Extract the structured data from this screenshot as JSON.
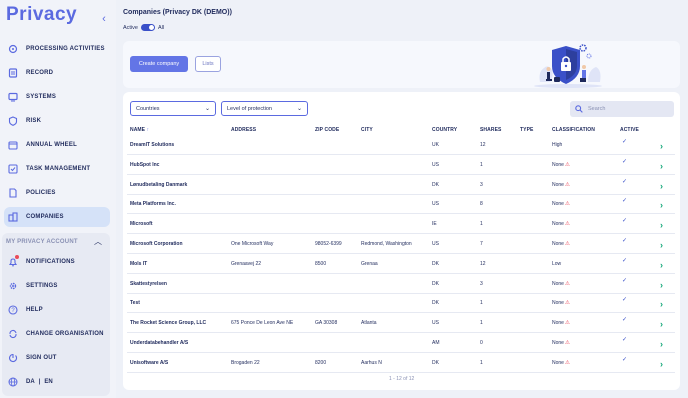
{
  "app": {
    "logo": "Privacy",
    "collapse_icon": "chevron-left-icon"
  },
  "sidebar": {
    "items": [
      {
        "label": "PROCESSING ACTIVITIES",
        "icon": "activities-icon"
      },
      {
        "label": "RECORD",
        "icon": "record-icon"
      },
      {
        "label": "SYSTEMS",
        "icon": "systems-icon"
      },
      {
        "label": "RISK",
        "icon": "risk-icon"
      },
      {
        "label": "ANNUAL WHEEL",
        "icon": "wheel-icon"
      },
      {
        "label": "TASK MANAGEMENT",
        "icon": "task-icon"
      },
      {
        "label": "POLICIES",
        "icon": "policies-icon"
      },
      {
        "label": "COMPANIES",
        "icon": "companies-icon"
      }
    ],
    "account_header": "MY PRIVACY ACCOUNT",
    "account_items": [
      {
        "label": "NOTIFICATIONS",
        "icon": "bell-icon"
      },
      {
        "label": "SETTINGS",
        "icon": "gear-icon"
      },
      {
        "label": "HELP",
        "icon": "help-icon"
      },
      {
        "label": "CHANGE ORGANISATION",
        "icon": "switch-icon"
      },
      {
        "label": "SIGN OUT",
        "icon": "sign-out-icon"
      }
    ],
    "lang": {
      "da": "DA",
      "sep": "|",
      "en": "EN"
    }
  },
  "page": {
    "title": "Companies (Privacy DK (DEMO))",
    "toggle_left": "Active",
    "toggle_right": "All"
  },
  "actions": {
    "create": "Create company",
    "lists": "Lists"
  },
  "filters": {
    "countries": "Countries",
    "level": "Level of protection",
    "search_placeholder": "Search"
  },
  "table": {
    "headers": {
      "name": "NAME",
      "address": "ADDRESS",
      "zip": "ZIP CODE",
      "city": "CITY",
      "country": "COUNTRY",
      "shares": "SHARES",
      "type": "TYPE",
      "classification": "CLASSIFICATION",
      "active": "ACTIVE"
    },
    "rows": [
      {
        "name": "DreamIT Solutions",
        "address": "",
        "zip": "",
        "city": "",
        "country": "UK",
        "shares": "12",
        "type": "",
        "classification": "High",
        "warn": false
      },
      {
        "name": "HubSpot Inc",
        "address": "",
        "zip": "",
        "city": "",
        "country": "US",
        "shares": "1",
        "type": "",
        "classification": "None",
        "warn": true
      },
      {
        "name": "Lønudbetaling Danmark",
        "address": "",
        "zip": "",
        "city": "",
        "country": "DK",
        "shares": "3",
        "type": "",
        "classification": "None",
        "warn": true
      },
      {
        "name": "Meta Platforms Inc.",
        "address": "",
        "zip": "",
        "city": "",
        "country": "US",
        "shares": "8",
        "type": "",
        "classification": "None",
        "warn": true
      },
      {
        "name": "Microsoft",
        "address": "",
        "zip": "",
        "city": "",
        "country": "IE",
        "shares": "1",
        "type": "",
        "classification": "None",
        "warn": true
      },
      {
        "name": "Microsoft Corporation",
        "address": "One Microsoft Way",
        "zip": "98052-6399",
        "city": "Redmond, Washington",
        "country": "US",
        "shares": "7",
        "type": "",
        "classification": "None",
        "warn": true
      },
      {
        "name": "Mols IT",
        "address": "Grenaavej 22",
        "zip": "8500",
        "city": "Grenaa",
        "country": "DK",
        "shares": "12",
        "type": "",
        "classification": "Low",
        "warn": false
      },
      {
        "name": "Skattestyrelsen",
        "address": "",
        "zip": "",
        "city": "",
        "country": "DK",
        "shares": "3",
        "type": "",
        "classification": "None",
        "warn": true
      },
      {
        "name": "Test",
        "address": "",
        "zip": "",
        "city": "",
        "country": "DK",
        "shares": "1",
        "type": "",
        "classification": "None",
        "warn": true
      },
      {
        "name": "The Rocket Science Group, LLC",
        "address": "675 Ponce De Leon Ave NE",
        "zip": "GA 30308",
        "city": "Atlanta",
        "country": "US",
        "shares": "1",
        "type": "",
        "classification": "None",
        "warn": true
      },
      {
        "name": "Underdatabehandler A/S",
        "address": "",
        "zip": "",
        "city": "",
        "country": "AM",
        "shares": "0",
        "type": "",
        "classification": "None",
        "warn": true
      },
      {
        "name": "Unisoftware A/S",
        "address": "Brogaden 22",
        "zip": "8200",
        "city": "Aarhus N",
        "country": "DK",
        "shares": "1",
        "type": "",
        "classification": "None",
        "warn": true
      }
    ],
    "active_mark": "✓",
    "row_arrow": "›",
    "warn_mark": "⚠"
  },
  "pagination": "1 - 12 of 12",
  "colors": {
    "accent": "#5b6ae0",
    "primary_button": "#6375e6",
    "text": "#1f2a5c",
    "warning": "#e94b5a",
    "arrow": "#16a77a"
  }
}
